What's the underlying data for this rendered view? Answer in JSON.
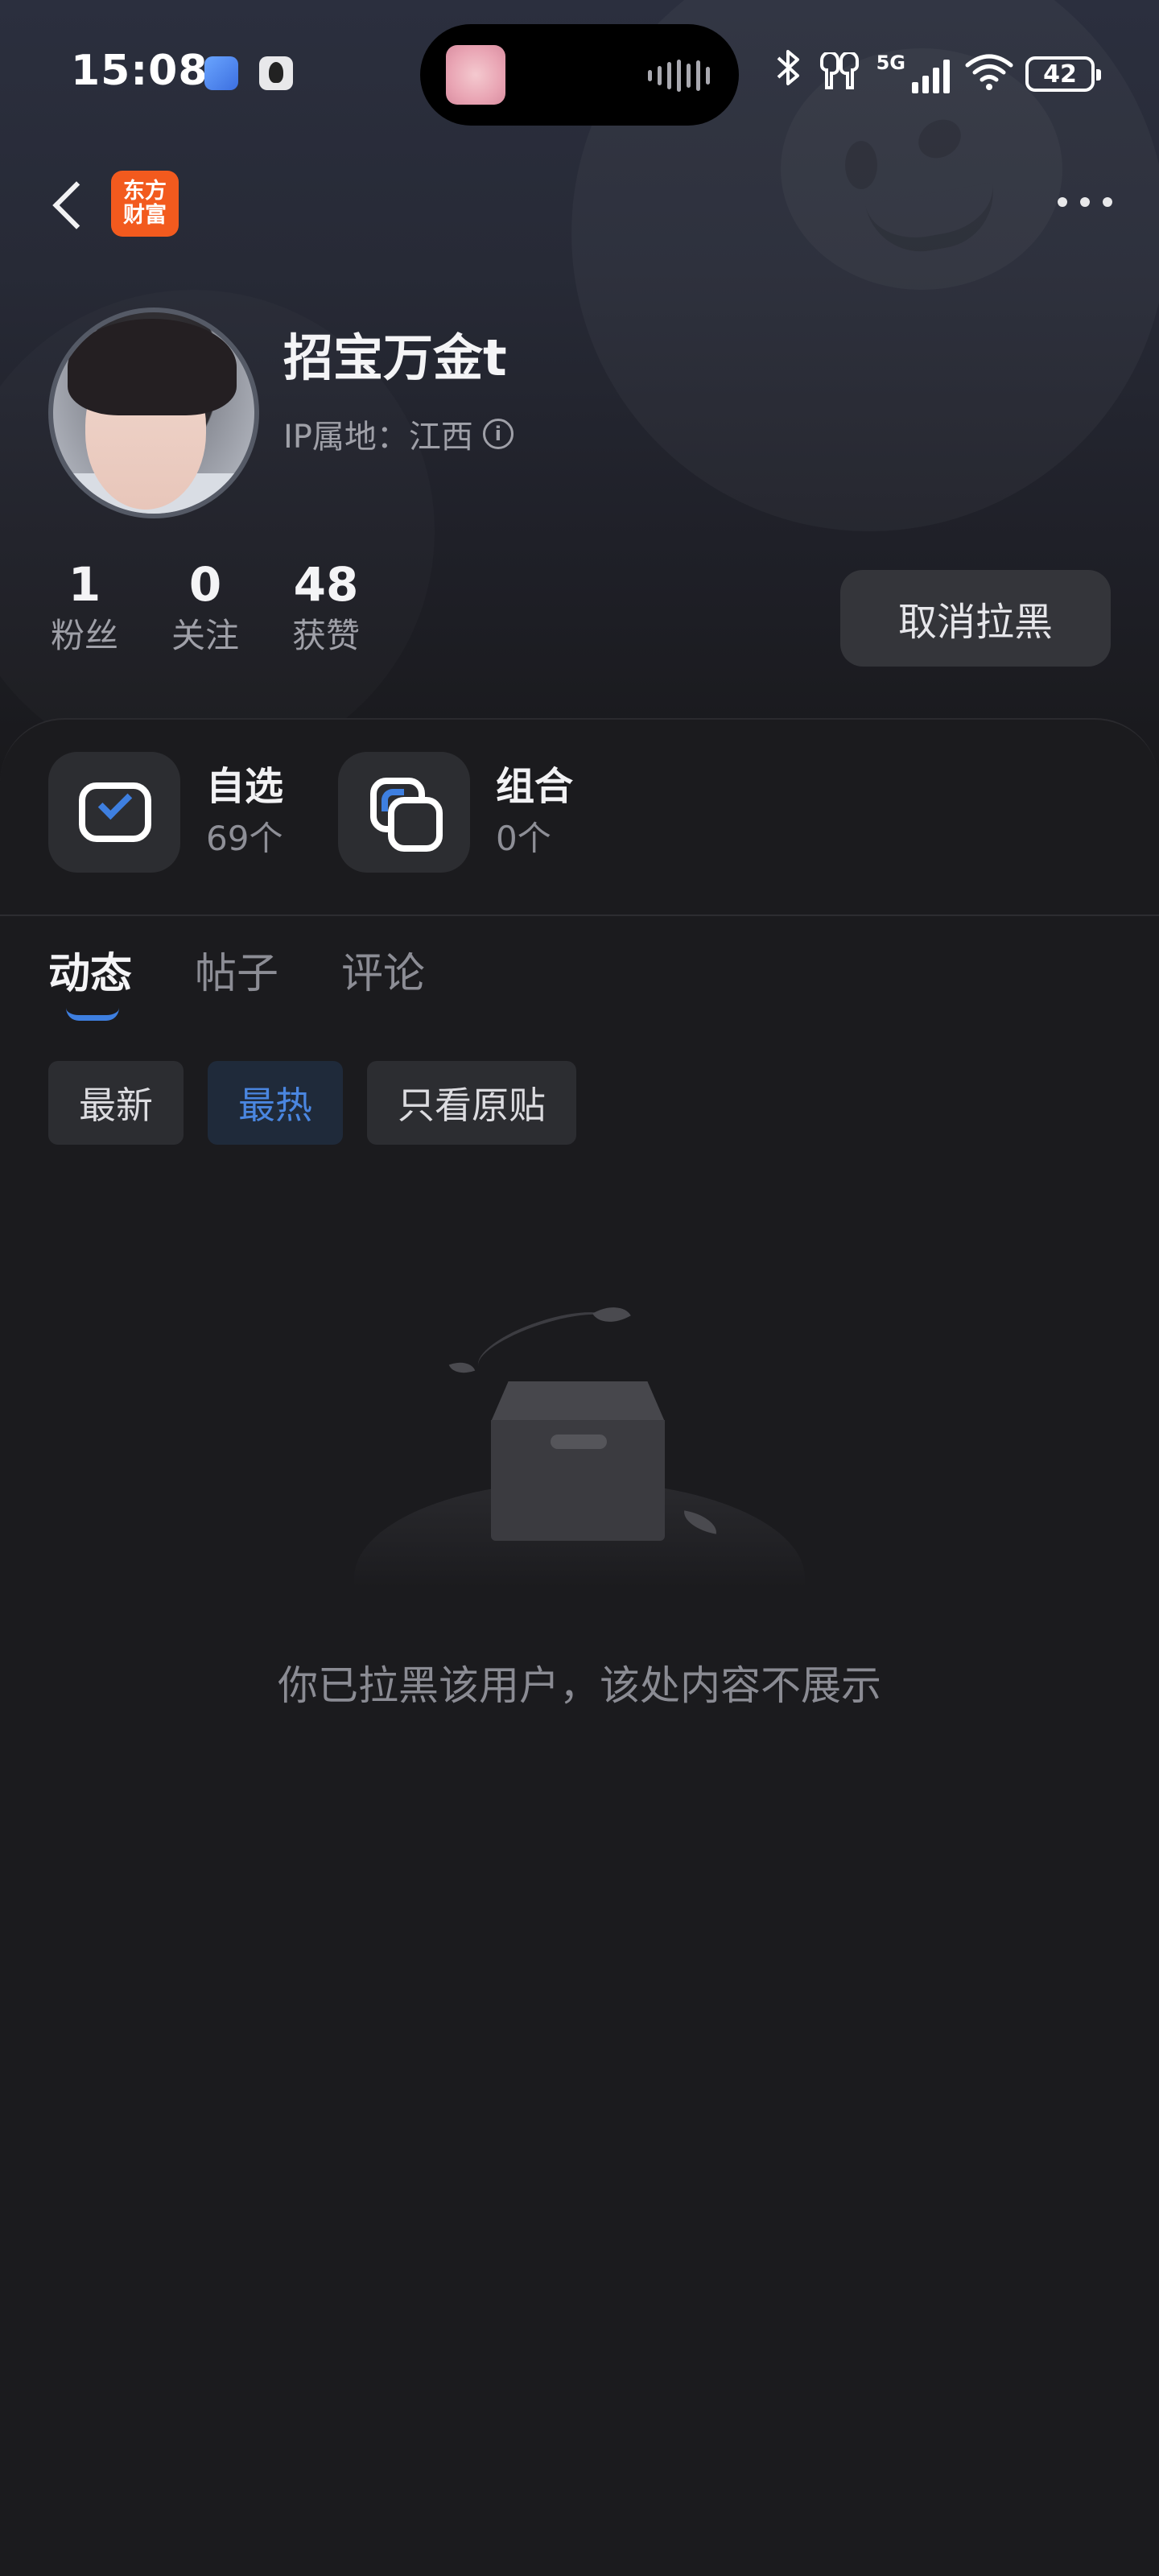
{
  "status_bar": {
    "time": "15:08",
    "network": "5G",
    "battery": "42",
    "icons": [
      "alipay-app-icon",
      "qq-app-icon",
      "bluetooth-icon",
      "earbuds-icon",
      "signal-icon",
      "wifi-icon",
      "battery-icon"
    ]
  },
  "nav": {
    "brand_line1": "东方",
    "brand_line2": "财富"
  },
  "profile": {
    "username": "招宝万金t",
    "ip_location": "IP属地：江西",
    "stats": [
      {
        "value": "1",
        "label": "粉丝"
      },
      {
        "value": "0",
        "label": "关注"
      },
      {
        "value": "48",
        "label": "获赞"
      }
    ],
    "unblock_label": "取消拉黑"
  },
  "shortcuts": [
    {
      "title": "自选",
      "sub": "69个",
      "icon": "watchlist-check-icon"
    },
    {
      "title": "组合",
      "sub": "0个",
      "icon": "portfolio-squares-icon"
    }
  ],
  "tabs": [
    {
      "label": "动态",
      "active": true
    },
    {
      "label": "帖子",
      "active": false
    },
    {
      "label": "评论",
      "active": false
    }
  ],
  "filters": [
    {
      "label": "最新",
      "active": false
    },
    {
      "label": "最热",
      "active": true
    },
    {
      "label": "只看原贴",
      "active": false
    }
  ],
  "empty_state": {
    "message": "你已拉黑该用户，该处内容不展示",
    "illustration": "empty-box-illustration"
  },
  "colors": {
    "background": "#19191c",
    "accent": "#3e7fe0",
    "brand": "#f25a1e",
    "muted_text": "#8a8b93"
  }
}
